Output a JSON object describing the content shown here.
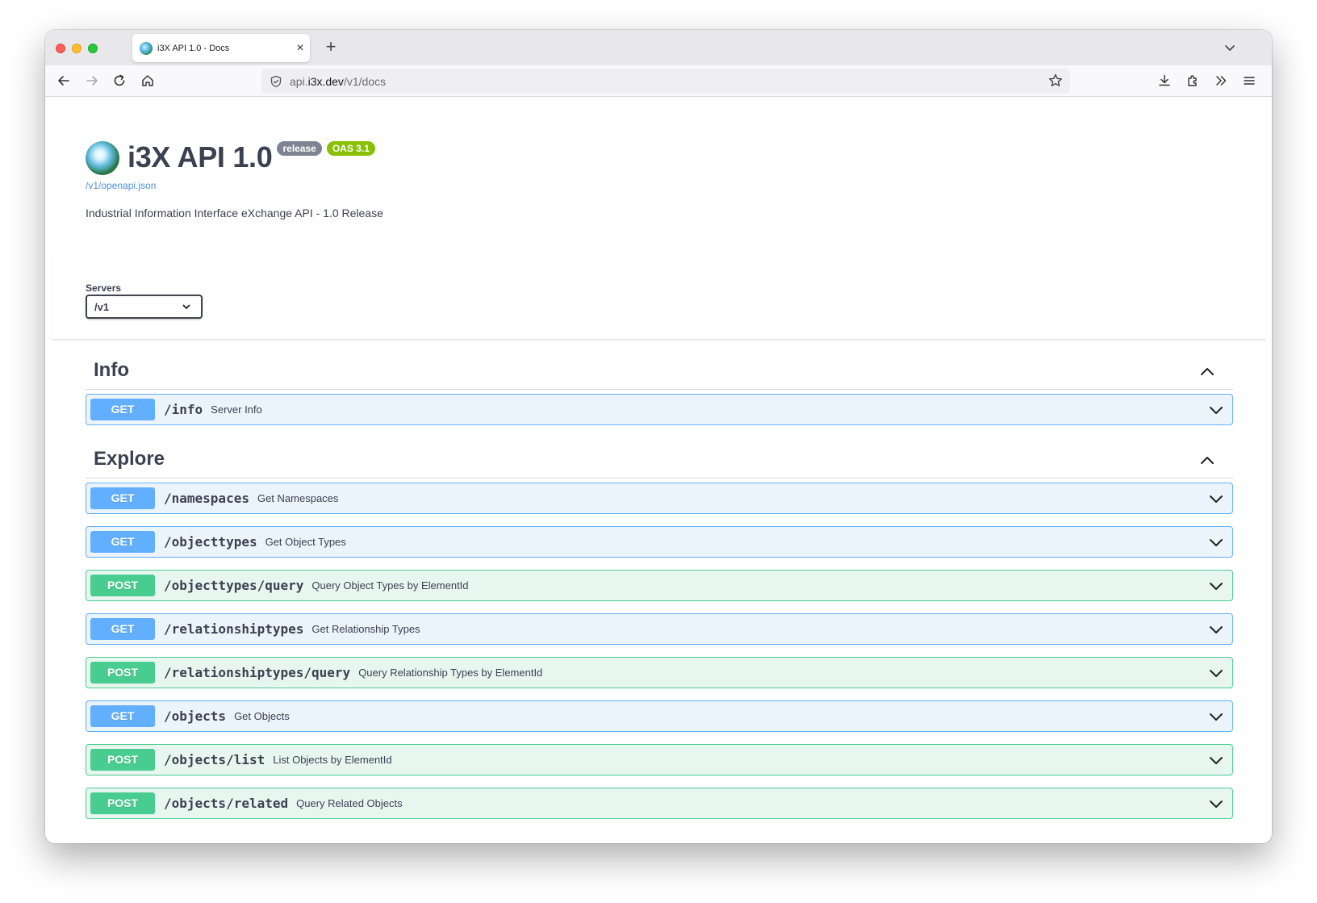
{
  "browser": {
    "tab_title": "i3X API 1.0 - Docs",
    "tab_close": "×",
    "new_tab": "+",
    "url_prefix": "api.",
    "url_host": "i3x.dev",
    "url_path": "/v1/docs"
  },
  "api": {
    "title": "i3X API 1.0",
    "version_badge": "release",
    "oas_badge": "OAS 3.1",
    "spec_link": "/v1/openapi.json",
    "description": "Industrial Information Interface eXchange API - 1.0 Release"
  },
  "servers": {
    "label": "Servers",
    "selected": "/v1"
  },
  "sections": [
    {
      "title": "Info",
      "operations": [
        {
          "method": "GET",
          "path": "/info",
          "summary": "Server Info"
        }
      ]
    },
    {
      "title": "Explore",
      "operations": [
        {
          "method": "GET",
          "path": "/namespaces",
          "summary": "Get Namespaces"
        },
        {
          "method": "GET",
          "path": "/objecttypes",
          "summary": "Get Object Types"
        },
        {
          "method": "POST",
          "path": "/objecttypes/query",
          "summary": "Query Object Types by ElementId"
        },
        {
          "method": "GET",
          "path": "/relationshiptypes",
          "summary": "Get Relationship Types"
        },
        {
          "method": "POST",
          "path": "/relationshiptypes/query",
          "summary": "Query Relationship Types by ElementId"
        },
        {
          "method": "GET",
          "path": "/objects",
          "summary": "Get Objects"
        },
        {
          "method": "POST",
          "path": "/objects/list",
          "summary": "List Objects by ElementId"
        },
        {
          "method": "POST",
          "path": "/objects/related",
          "summary": "Query Related Objects"
        }
      ]
    }
  ],
  "colors": {
    "get": "#61affe",
    "post": "#49cc90",
    "badge_gray": "#7d8492",
    "badge_green": "#89bf04",
    "link": "#4990e2"
  }
}
